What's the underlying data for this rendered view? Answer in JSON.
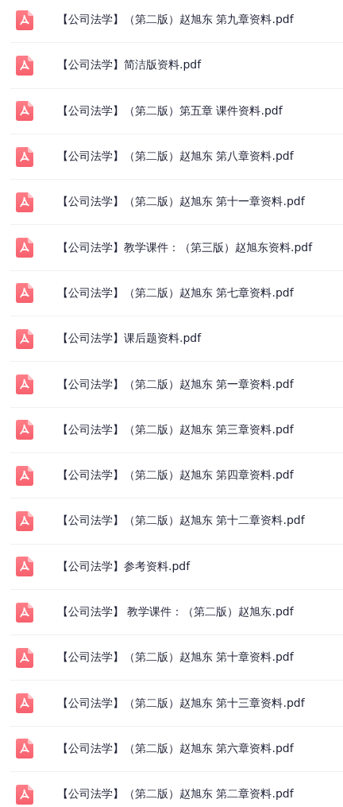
{
  "files": [
    {
      "name": "【公司法学】（第二版）赵旭东 第九章资料.pdf"
    },
    {
      "name": "【公司法学】简洁版资料.pdf"
    },
    {
      "name": "【公司法学】（第二版）第五章 课件资料.pdf"
    },
    {
      "name": "【公司法学】（第二版）赵旭东 第八章资料.pdf"
    },
    {
      "name": "【公司法学】（第二版）赵旭东 第十一章资料.pdf"
    },
    {
      "name": "【公司法学】教学课件：（第三版）赵旭东资料.pdf"
    },
    {
      "name": "【公司法学】（第二版）赵旭东 第七章资料.pdf"
    },
    {
      "name": "【公司法学】课后题资料.pdf"
    },
    {
      "name": "【公司法学】（第二版）赵旭东 第一章资料.pdf"
    },
    {
      "name": "【公司法学】（第二版）赵旭东 第三章资料.pdf"
    },
    {
      "name": "【公司法学】（第二版）赵旭东 第四章资料.pdf"
    },
    {
      "name": "【公司法学】（第二版）赵旭东 第十二章资料.pdf"
    },
    {
      "name": "【公司法学】参考资料.pdf"
    },
    {
      "name": "【公司法学】 教学课件：（第二版）赵旭东.pdf"
    },
    {
      "name": "【公司法学】（第二版）赵旭东 第十章资料.pdf"
    },
    {
      "name": "【公司法学】（第二版）赵旭东 第十三章资料.pdf"
    },
    {
      "name": "【公司法学】（第二版）赵旭东 第六章资料.pdf"
    },
    {
      "name": "【公司法学】（第二版）赵旭东 第二章资料.pdf"
    }
  ]
}
